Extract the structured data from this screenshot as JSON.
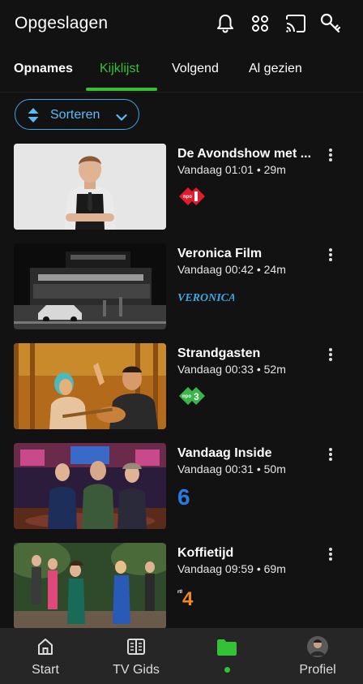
{
  "header": {
    "title": "Opgeslagen",
    "icons": [
      "bell-icon",
      "apps-grid-icon",
      "cast-icon",
      "key-icon"
    ]
  },
  "tabs": [
    {
      "label": "Opnames",
      "active": false
    },
    {
      "label": "Kijklijst",
      "active": true
    },
    {
      "label": "Volgend",
      "active": false
    },
    {
      "label": "Al gezien",
      "active": false
    }
  ],
  "sort": {
    "label": "Sorteren"
  },
  "items": [
    {
      "title": "De Avondshow met ...",
      "meta": "Vandaag 01:01 • 29m",
      "channel": "NPO 1"
    },
    {
      "title": "Veronica Film",
      "meta": "Vandaag 00:42 • 24m",
      "channel": "VERONICA"
    },
    {
      "title": "Strandgasten",
      "meta": "Vandaag 00:33 • 52m",
      "channel": "NPO 3"
    },
    {
      "title": "Vandaag Inside",
      "meta": "Vandaag 00:31 • 50m",
      "channel": "6"
    },
    {
      "title": "Koffietijd",
      "meta": "Vandaag 09:59 • 69m",
      "channel": "RTL 4"
    }
  ],
  "nav": [
    {
      "label": "Start",
      "icon": "home-icon"
    },
    {
      "label": "TV Gids",
      "icon": "tv-guide-icon"
    },
    {
      "label": "",
      "icon": "folder-icon",
      "active": true
    },
    {
      "label": "Profiel",
      "icon": "avatar"
    }
  ],
  "colors": {
    "accent": "#35c135",
    "sort_accent": "#3aa8e6",
    "background": "#121212",
    "nav_bg": "#262626"
  }
}
